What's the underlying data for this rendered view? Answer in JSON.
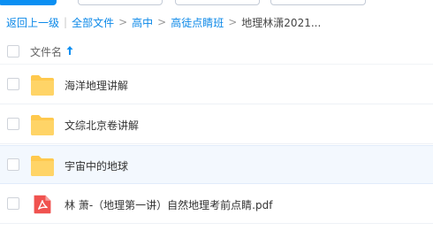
{
  "breadcrumb": {
    "back": "返回上一级",
    "all_files": "全部文件",
    "level1": "高中",
    "level2": "高徒点睛班",
    "current": "地理林潇2021..."
  },
  "list_header": {
    "name_label": "文件名"
  },
  "files": [
    {
      "name": "海洋地理讲解",
      "type": "folder"
    },
    {
      "name": "文综北京卷讲解",
      "type": "folder"
    },
    {
      "name": "宇宙中的地球",
      "type": "folder"
    },
    {
      "name": "林 萧-（地理第一讲）自然地理考前点睛.pdf",
      "type": "pdf"
    }
  ],
  "colors": {
    "accent": "#0b8ff2",
    "folder": "#ffc94d",
    "pdf": "#f0524f",
    "link": "#0b88e8"
  }
}
